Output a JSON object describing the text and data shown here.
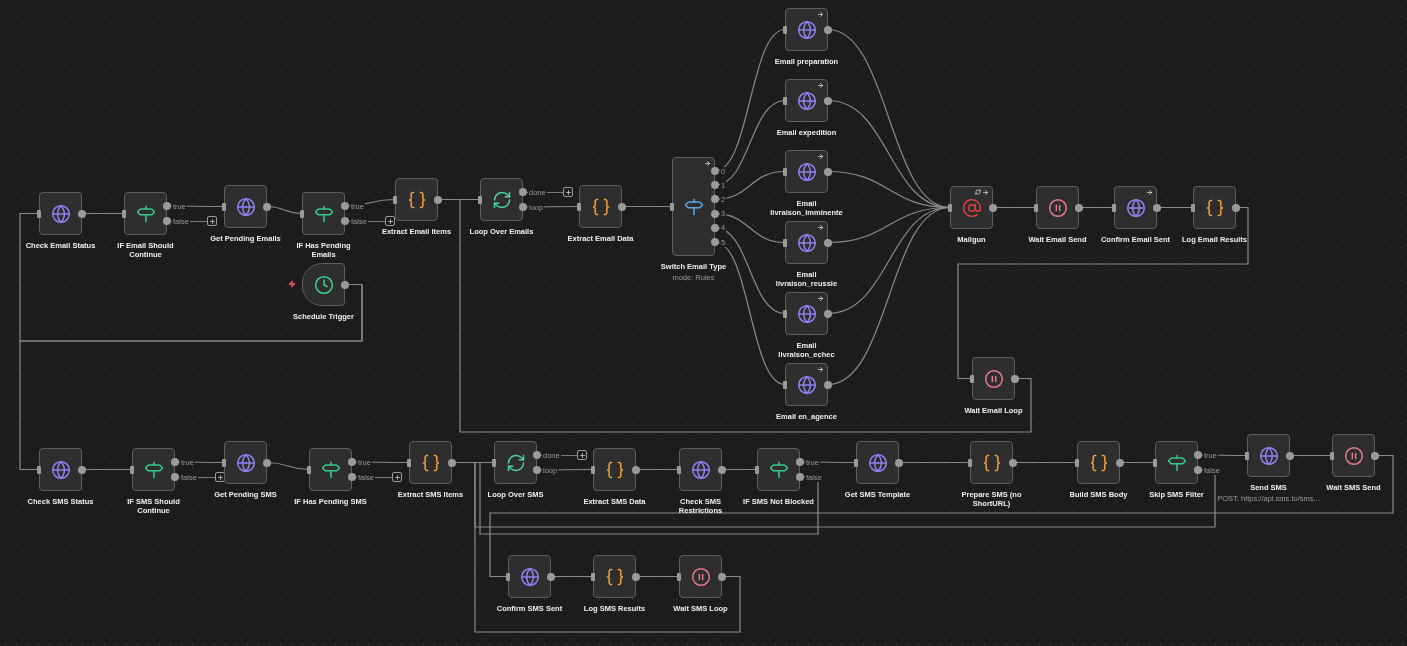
{
  "canvas": {
    "nodes": [
      {
        "label": "Check Email Status",
        "kind": "http",
        "arrow_badge": false,
        "retry_badge": false
      },
      {
        "label": "IF Email Should Continue",
        "kind": "if",
        "arrow_badge": false,
        "retry_badge": false,
        "outputs": [
          {
            "label": "true",
            "add_button": false
          },
          {
            "label": "false",
            "add_button": true
          }
        ]
      },
      {
        "label": "Get Pending Emails",
        "kind": "http",
        "arrow_badge": false,
        "retry_badge": false
      },
      {
        "label": "IF Has Pending Emails",
        "kind": "if",
        "arrow_badge": false,
        "retry_badge": false,
        "outputs": [
          {
            "label": "true",
            "add_button": false
          },
          {
            "label": "false",
            "add_button": true
          }
        ]
      },
      {
        "label": "Extract Email Items",
        "kind": "code",
        "arrow_badge": false,
        "retry_badge": false
      },
      {
        "label": "Loop Over Emails",
        "kind": "loop",
        "arrow_badge": false,
        "retry_badge": false,
        "outputs": [
          {
            "label": "done",
            "add_button": true
          },
          {
            "label": "loop",
            "add_button": false
          }
        ]
      },
      {
        "label": "Extract Email Data",
        "kind": "code",
        "arrow_badge": false,
        "retry_badge": false
      },
      {
        "label": "Switch Email Type",
        "subtitle": "mode: Rules",
        "kind": "switch",
        "arrow_badge": true,
        "retry_badge": false,
        "outputs": [
          {
            "label": "0",
            "add_button": false
          },
          {
            "label": "1",
            "add_button": false
          },
          {
            "label": "2",
            "add_button": false
          },
          {
            "label": "3",
            "add_button": false
          },
          {
            "label": "4",
            "add_button": false
          },
          {
            "label": "5",
            "add_button": false
          }
        ]
      },
      {
        "label": "Email preparation",
        "kind": "http",
        "arrow_badge": true,
        "retry_badge": false
      },
      {
        "label": "Email expedition",
        "kind": "http",
        "arrow_badge": true,
        "retry_badge": false
      },
      {
        "label": "Email livraison_imminente",
        "kind": "http",
        "arrow_badge": true,
        "retry_badge": false
      },
      {
        "label": "Email livraison_reussie",
        "kind": "http",
        "arrow_badge": true,
        "retry_badge": false
      },
      {
        "label": "Email livraison_echec",
        "kind": "http",
        "arrow_badge": true,
        "retry_badge": false
      },
      {
        "label": "Email en_agence",
        "kind": "http",
        "arrow_badge": true,
        "retry_badge": false
      },
      {
        "label": "Mailgun",
        "kind": "mailgun",
        "arrow_badge": true,
        "retry_badge": true
      },
      {
        "label": "Wait Email Send",
        "kind": "wait",
        "arrow_badge": false,
        "retry_badge": false
      },
      {
        "label": "Confirm Email Sent",
        "kind": "http",
        "arrow_badge": true,
        "retry_badge": false
      },
      {
        "label": "Log Email Results",
        "kind": "code",
        "arrow_badge": false,
        "retry_badge": false
      },
      {
        "label": "Wait Email Loop",
        "kind": "wait",
        "arrow_badge": false,
        "retry_badge": false
      },
      {
        "label": "Schedule Trigger",
        "kind": "schedule",
        "arrow_badge": false,
        "retry_badge": false
      },
      {
        "label": "Check SMS Status",
        "kind": "http",
        "arrow_badge": false,
        "retry_badge": false
      },
      {
        "label": "IF SMS Should Continue",
        "kind": "if",
        "arrow_badge": false,
        "retry_badge": false,
        "outputs": [
          {
            "label": "true",
            "add_button": false
          },
          {
            "label": "false",
            "add_button": true
          }
        ]
      },
      {
        "label": "Get Pending SMS",
        "kind": "http",
        "arrow_badge": false,
        "retry_badge": false
      },
      {
        "label": "IF Has Pending SMS",
        "kind": "if",
        "arrow_badge": false,
        "retry_badge": false,
        "outputs": [
          {
            "label": "true",
            "add_button": false
          },
          {
            "label": "false",
            "add_button": true
          }
        ]
      },
      {
        "label": "Extract SMS Items",
        "kind": "code",
        "arrow_badge": false,
        "retry_badge": false
      },
      {
        "label": "Loop Over SMS",
        "kind": "loop",
        "arrow_badge": false,
        "retry_badge": false,
        "outputs": [
          {
            "label": "done",
            "add_button": true
          },
          {
            "label": "loop",
            "add_button": false
          }
        ]
      },
      {
        "label": "Extract SMS Data",
        "kind": "code",
        "arrow_badge": false,
        "retry_badge": false
      },
      {
        "label": "Check SMS Restrictions",
        "kind": "http",
        "arrow_badge": false,
        "retry_badge": false
      },
      {
        "label": "IF SMS Not Blocked",
        "kind": "if",
        "arrow_badge": false,
        "retry_badge": false,
        "outputs": [
          {
            "label": "true",
            "add_button": false
          },
          {
            "label": "false",
            "add_button": false
          }
        ]
      },
      {
        "label": "Get SMS Template",
        "kind": "http",
        "arrow_badge": false,
        "retry_badge": false
      },
      {
        "label": "Prepare SMS (no ShortURL)",
        "kind": "code",
        "arrow_badge": false,
        "retry_badge": false
      },
      {
        "label": "Build SMS Body",
        "kind": "code",
        "arrow_badge": false,
        "retry_badge": false
      },
      {
        "label": "Skip SMS Filter",
        "kind": "if",
        "arrow_badge": false,
        "retry_badge": false,
        "outputs": [
          {
            "label": "true",
            "add_button": false
          },
          {
            "label": "false",
            "add_button": false
          }
        ]
      },
      {
        "label": "Send SMS",
        "subtitle": "POST: https://api.sms.to/sms...",
        "kind": "http",
        "arrow_badge": false,
        "retry_badge": false
      },
      {
        "label": "Wait SMS Send",
        "kind": "wait",
        "arrow_badge": false,
        "retry_badge": false
      },
      {
        "label": "Confirm SMS Sent",
        "kind": "http",
        "arrow_badge": false,
        "retry_badge": false
      },
      {
        "label": "Log SMS Results",
        "kind": "code",
        "arrow_badge": false,
        "retry_badge": false
      },
      {
        "label": "Wait SMS Loop",
        "kind": "wait",
        "arrow_badge": false,
        "retry_badge": false
      }
    ]
  }
}
